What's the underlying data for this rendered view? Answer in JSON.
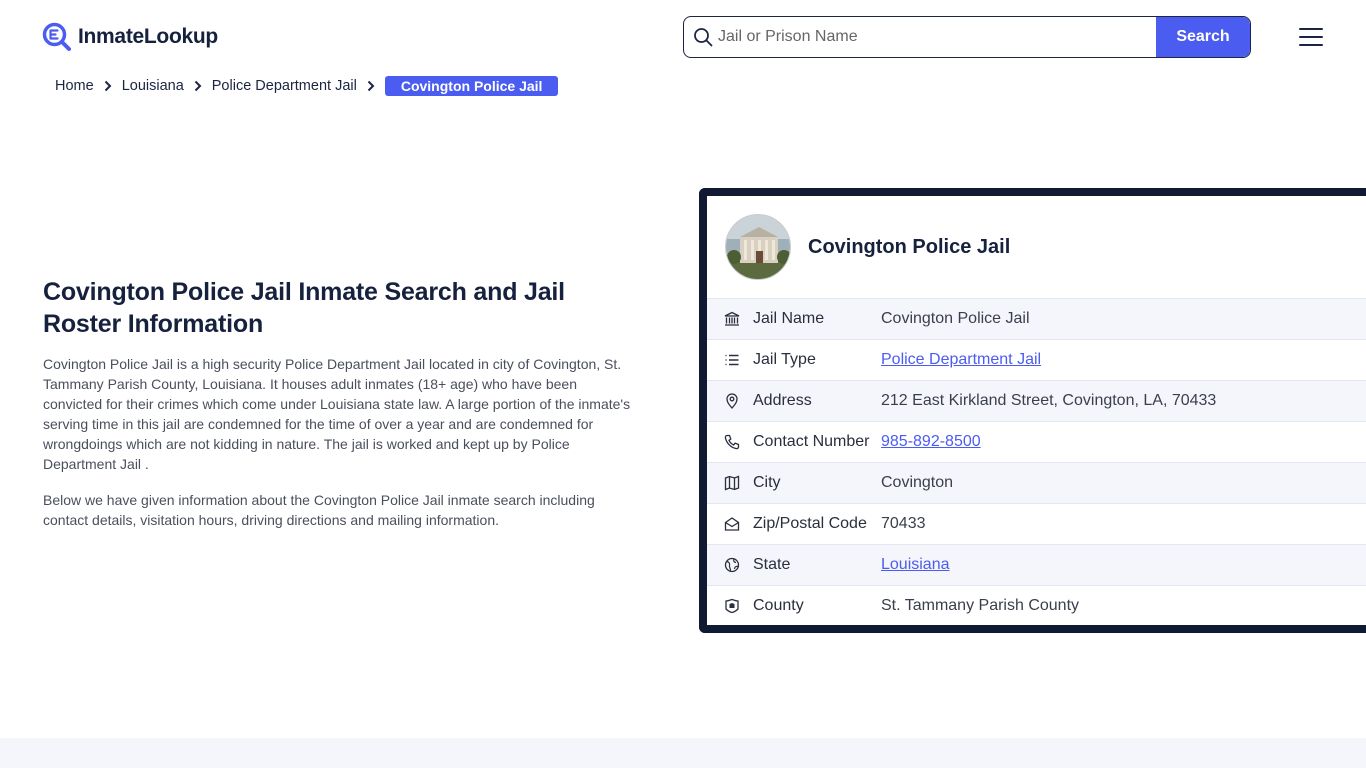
{
  "header": {
    "logo_text": "InmateLookup",
    "search_placeholder": "Jail or Prison Name",
    "search_button": "Search"
  },
  "breadcrumb": {
    "items": [
      "Home",
      "Louisiana",
      "Police Department Jail"
    ],
    "active": "Covington Police Jail"
  },
  "main": {
    "title": "Covington Police Jail Inmate Search and Jail Roster Information",
    "paragraph1": "Covington Police Jail is a high security Police Department Jail located in city of Covington, St. Tammany Parish County, Louisiana. It houses adult inmates (18+ age) who have been convicted for their crimes which come under Louisiana state law. A large portion of the inmate's serving time in this jail are condemned for the time of over a year and are condemned for wrongdoings which are not kidding in nature. The jail is worked and kept up by Police Department Jail .",
    "paragraph2": "Below we have given information about the Covington Police Jail inmate search including contact details, visitation hours, driving directions and mailing information."
  },
  "card": {
    "title": "Covington Police Jail",
    "rows": [
      {
        "icon": "bank-icon",
        "label": "Jail Name",
        "value": "Covington Police Jail"
      },
      {
        "icon": "list-icon",
        "label": "Jail Type",
        "value": "Police Department Jail"
      },
      {
        "icon": "location-pin-icon",
        "label": "Address",
        "value": "212 East Kirkland Street, Covington, LA, 70433"
      },
      {
        "icon": "phone-icon",
        "label": "Contact Number",
        "value": "985-892-8500"
      },
      {
        "icon": "map-icon",
        "label": "City",
        "value": "Covington"
      },
      {
        "icon": "mail-open-icon",
        "label": "Zip/Postal Code",
        "value": "70433"
      },
      {
        "icon": "globe-icon",
        "label": "State",
        "value": "Louisiana"
      },
      {
        "icon": "badge-icon",
        "label": "County",
        "value": "St. Tammany Parish County"
      }
    ]
  },
  "colors": {
    "accent": "#4b5cf0",
    "dark": "#111a33",
    "text": "#16213d"
  }
}
